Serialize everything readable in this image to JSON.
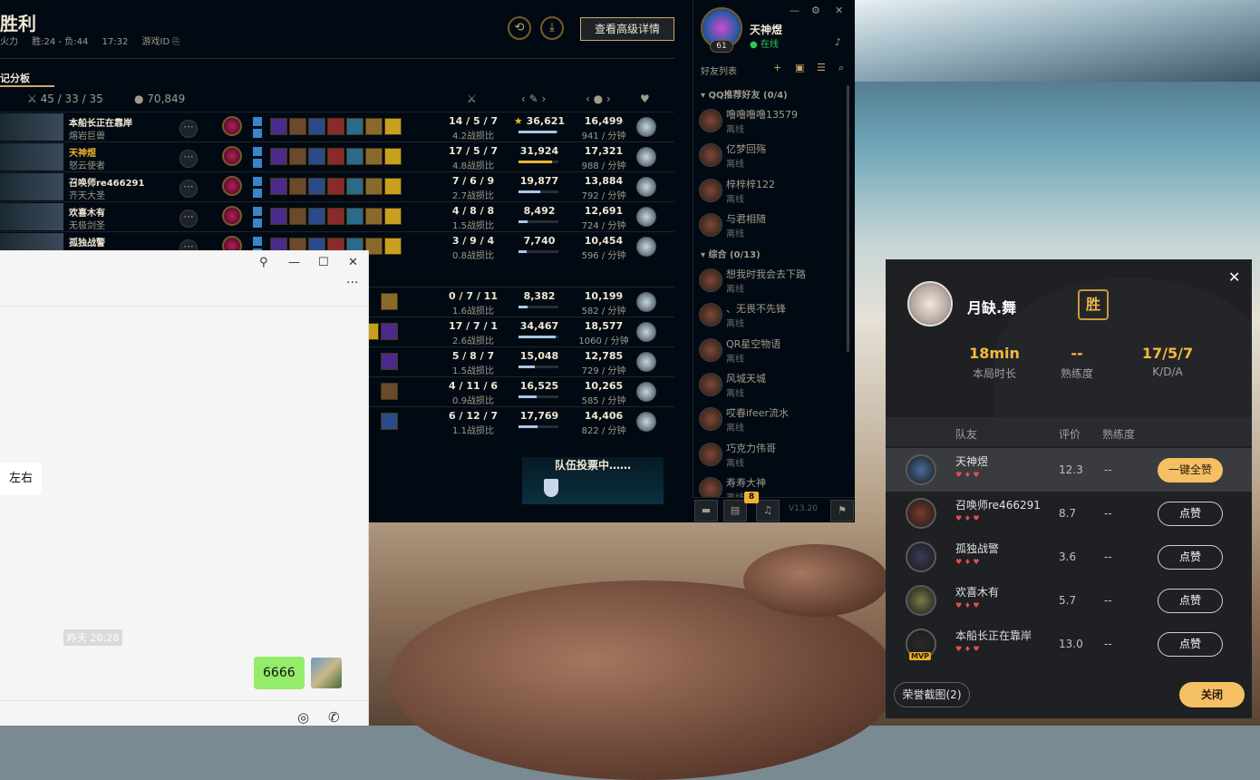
{
  "lol": {
    "title": "胜利",
    "meta": [
      "火力",
      "胜:24 - 负:44",
      "17:32",
      "游戏ID ⎘"
    ],
    "advanced_button": "查看高级详情",
    "tab": "记分板",
    "team_kda": "45 / 33 / 35",
    "team_gold": "70,849",
    "players": [
      {
        "name": "本船长正在靠岸",
        "title": "熔岩巨兽",
        "kda": "14 / 5 / 7",
        "ratio": "4.2战损比",
        "dmg": "36,621",
        "star": true,
        "bar": 0.95,
        "gold": "16,499",
        "gpm": "941 / 分钟"
      },
      {
        "name": "天神煜",
        "title": "怒云使者",
        "kda": "17 / 5 / 7",
        "ratio": "4.8战损比",
        "dmg": "31,924",
        "bar": 0.85,
        "gold": "17,321",
        "gpm": "988 / 分钟",
        "me": true
      },
      {
        "name": "召唤师re466291",
        "title": "齐天大圣",
        "kda": "7 / 6 / 9",
        "ratio": "2.7战损比",
        "dmg": "19,877",
        "bar": 0.55,
        "gold": "13,884",
        "gpm": "792 / 分钟"
      },
      {
        "name": "欢喜木有",
        "title": "无极剑圣",
        "kda": "4 / 8 / 8",
        "ratio": "1.5战损比",
        "dmg": "8,492",
        "bar": 0.22,
        "gold": "12,691",
        "gpm": "724 / 分钟"
      },
      {
        "name": "孤独战警",
        "title": "",
        "kda": "3 / 9 / 4",
        "ratio": "0.8战损比",
        "dmg": "7,740",
        "bar": 0.2,
        "gold": "10,454",
        "gpm": "596 / 分钟"
      },
      {
        "name": "",
        "title": "",
        "kda": "0 / 7 / 11",
        "ratio": "1.6战损比",
        "dmg": "8,382",
        "bar": 0.23,
        "gold": "10,199",
        "gpm": "582 / 分钟"
      },
      {
        "name": "",
        "title": "",
        "kda": "17 / 7 / 1",
        "ratio": "2.6战损比",
        "dmg": "34,467",
        "bar": 0.94,
        "gold": "18,577",
        "gpm": "1060 / 分钟"
      },
      {
        "name": "",
        "title": "",
        "kda": "5 / 8 / 7",
        "ratio": "1.5战损比",
        "dmg": "15,048",
        "bar": 0.41,
        "gold": "12,785",
        "gpm": "729 / 分钟"
      },
      {
        "name": "",
        "title": "",
        "kda": "4 / 11 / 6",
        "ratio": "0.9战损比",
        "dmg": "16,525",
        "bar": 0.45,
        "gold": "10,265",
        "gpm": "585 / 分钟"
      },
      {
        "name": "",
        "title": "",
        "kda": "6 / 12 / 7",
        "ratio": "1.1战损比",
        "dmg": "17,769",
        "bar": 0.48,
        "gold": "14,406",
        "gpm": "822 / 分钟"
      }
    ],
    "vote_text": "队伍投票中……"
  },
  "friends": {
    "username": "天神煜",
    "status": "在线",
    "level": "61",
    "list_label": "好友列表",
    "group1": "QQ推荐好友 (0/4)",
    "group2": "综合 (0/13)",
    "offline": "离线",
    "g1": [
      "噜噜噜噜13579",
      "亿梦回殇",
      "梓梓梓122",
      "与君相随"
    ],
    "g2": [
      "想我时我会去下路",
      "、无畏不先锋",
      "QR星空物语",
      "风城天城",
      "哎春ifeer流水",
      "巧克力伟哥",
      "寿寿大神"
    ],
    "badge": "8",
    "version": "V13.20"
  },
  "chat": {
    "left_bubble": "左右",
    "timestamp": "昨天 20:28",
    "right_bubble": "6666"
  },
  "popup": {
    "name": "月缺.舞",
    "result": "胜",
    "stats": [
      {
        "value": "18min",
        "label": "本局时长"
      },
      {
        "value": "--",
        "label": "熟练度"
      },
      {
        "value": "17/5/7",
        "label": "K/D/A"
      }
    ],
    "headers": [
      "队友",
      "评价",
      "熟练度"
    ],
    "rows": [
      {
        "name": "天神煜",
        "score": "12.3",
        "prof": "--",
        "btn": "一键全赞"
      },
      {
        "name": "召唤师re466291",
        "score": "8.7",
        "prof": "--",
        "btn": "点赞"
      },
      {
        "name": "孤独战警",
        "score": "3.6",
        "prof": "--",
        "btn": "点赞"
      },
      {
        "name": "欢喜木有",
        "score": "5.7",
        "prof": "--",
        "btn": "点赞"
      },
      {
        "name": "本船长正在靠岸",
        "score": "13.0",
        "prof": "--",
        "btn": "点赞",
        "mvp": "MVP"
      }
    ],
    "screenshot_btn": "荣誉截图(2)",
    "close_btn": "关闭"
  }
}
